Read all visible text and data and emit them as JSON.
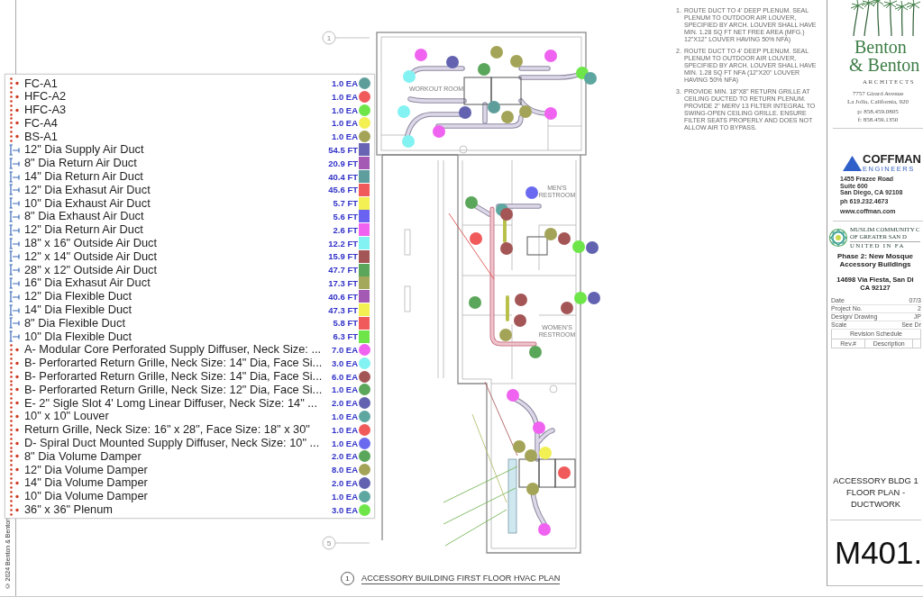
{
  "sheet_margin": {
    "copyright": "© 2024 Benton & Benton"
  },
  "legend": {
    "items": [
      {
        "kind": "count",
        "label": "FC-A1",
        "quantity": "1.0 EA",
        "color": "#5e9e9a"
      },
      {
        "kind": "count",
        "label": "HFC-A2",
        "quantity": "1.0 EA",
        "color": "#f05a5a"
      },
      {
        "kind": "count",
        "label": "HFC-A3",
        "quantity": "1.0 EA",
        "color": "#6ee64a"
      },
      {
        "kind": "count",
        "label": "FC-A4",
        "quantity": "1.0 EA",
        "color": "#f2f052"
      },
      {
        "kind": "count",
        "label": "BS-A1",
        "quantity": "1.0 EA",
        "color": "#a4a458"
      },
      {
        "kind": "length",
        "label": "12\" Dia Supply Air Duct",
        "quantity": "54.5 FT",
        "color": "#6a64b4"
      },
      {
        "kind": "length",
        "label": "8\" Dia Return Air Duct",
        "quantity": "20.9 FT",
        "color": "#a45ab4"
      },
      {
        "kind": "length",
        "label": "14\" Dia Return Air Duct",
        "quantity": "40.4 FT",
        "color": "#5e9e9e"
      },
      {
        "kind": "length",
        "label": "12\" Dia Exhasut Air Duct",
        "quantity": "45.6 FT",
        "color": "#f05a5a"
      },
      {
        "kind": "length",
        "label": "10\" Dia Exhaust Air Duct",
        "quantity": "5.7 FT",
        "color": "#f2f052"
      },
      {
        "kind": "length",
        "label": "8\" Dia Exhaust Air Duct",
        "quantity": "5.6 FT",
        "color": "#6a62f0"
      },
      {
        "kind": "length",
        "label": "12\" Dia Return Air Duct",
        "quantity": "2.6 FT",
        "color": "#f062f0"
      },
      {
        "kind": "length",
        "label": "18\" x 16\" Outside Air Duct",
        "quantity": "12.2 FT",
        "color": "#82f2f2"
      },
      {
        "kind": "length",
        "label": "12\" x 14\" Outside Air Duct",
        "quantity": "15.9 FT",
        "color": "#a45656"
      },
      {
        "kind": "length",
        "label": "28\" x 12\" Outside Air Duct",
        "quantity": "47.7 FT",
        "color": "#5aa65a"
      },
      {
        "kind": "length",
        "label": "16\" Dia Exhasut Air Duct",
        "quantity": "17.3 FT",
        "color": "#a4a85a"
      },
      {
        "kind": "length",
        "label": "12\" Dia Flexible Duct",
        "quantity": "40.6 FT",
        "color": "#a45ab4"
      },
      {
        "kind": "length",
        "label": "14\" Dia Flexible Duct",
        "quantity": "47.3 FT",
        "color": "#f2f052"
      },
      {
        "kind": "length",
        "label": "8\" Dia Flexible Duct",
        "quantity": "5.8 FT",
        "color": "#f05a5a"
      },
      {
        "kind": "length",
        "label": "10\" Dla Flexible Duct",
        "quantity": "6.3 FT",
        "color": "#6ee64a"
      },
      {
        "kind": "count",
        "label": "A- Modular Core Perforated Supply Diffuser, Neck Size: ...",
        "quantity": "7.0 EA",
        "color": "#f062f0"
      },
      {
        "kind": "count",
        "label": "B- Perforarted Return Grille, Neck Size: 14\" Dia, Face Si...",
        "quantity": "3.0 EA",
        "color": "#82f2f2"
      },
      {
        "kind": "count",
        "label": "B- Perforarted Return Grille, Neck Size: 14\" Dia, Face Si...",
        "quantity": "6.0 EA",
        "color": "#a45656"
      },
      {
        "kind": "count",
        "label": "B- Perforarted Return Grille, Neck Size: 12\" Dia, Face Si...",
        "quantity": "1.0 EA",
        "color": "#5aa65a"
      },
      {
        "kind": "count",
        "label": "E- 2\" Sigle Slot 4' Lomg Linear Diffuser, Neck Size: 14\" ...",
        "quantity": "2.0 EA",
        "color": "#6262b0"
      },
      {
        "kind": "count",
        "label": "10\" x 10\" Louver",
        "quantity": "1.0 EA",
        "color": "#5ea6a0"
      },
      {
        "kind": "count",
        "label": "Return Grille, Neck Size: 16\" x 28\", Face Size: 18\" x 30\"",
        "quantity": "1.0 EA",
        "color": "#f05a5a"
      },
      {
        "kind": "count",
        "label": "D- Spiral Duct Mounted Supply Diffuser, Neck Size: 10\" ...",
        "quantity": "1.0 EA",
        "color": "#6a6af0"
      },
      {
        "kind": "count",
        "label": "8\" Dia Volume Damper",
        "quantity": "2.0 EA",
        "color": "#5aa65a"
      },
      {
        "kind": "count",
        "label": "12\" Dia Volume Damper",
        "quantity": "8.0 EA",
        "color": "#a4a458"
      },
      {
        "kind": "count",
        "label": "14\" Dia Volume Damper",
        "quantity": "2.0 EA",
        "color": "#6262b0"
      },
      {
        "kind": "count",
        "label": "10\" Dia Volume Damper",
        "quantity": "1.0 EA",
        "color": "#5ea6a0"
      },
      {
        "kind": "count",
        "label": "36\" x 36\" Plenum",
        "quantity": "3.0 EA",
        "color": "#6ee64a"
      }
    ]
  },
  "plan": {
    "grid_bubbles": [
      "1",
      "5"
    ],
    "rooms": [
      {
        "lines": [
          "WORKOUT ROOM"
        ]
      },
      {
        "lines": [
          "MEN'S",
          "RESTROOM"
        ]
      },
      {
        "lines": [
          "WOMEN'S",
          "RESTROOM"
        ]
      }
    ],
    "title_number": "1",
    "title": "ACCESSORY BUILDING FIRST FLOOR HVAC PLAN"
  },
  "notes": [
    {
      "number": "1.",
      "text": "ROUTE DUCT TO 4' DEEP PLENUM. SEAL PLENUM TO OUTDOOR AIR LOUVER, SPECIFIED BY ARCH. LOUVER SHALL HAVE MIN. 1.28 SQ FT NET FREE AREA (MFG.) 12\"X12\" LOUVER HAVING 50% NFA)"
    },
    {
      "number": "2.",
      "text": "ROUTE DUCT TO 4' DEEP PLENUM. SEAL PLENUM TO OUTDOOR AIR LOUVER, SPECIFIED BY ARCH. LOUVER SHALL HAVE MIN. 1.28 SQ FT NFA (12\"X20\" LOUVER HAVING 50% NFA)"
    },
    {
      "number": "3.",
      "text": "PROVIDE MIN. 18\"X8\" RETURN GRILLE AT CEILING DUCTED TO RETURN PLENUM. PROVIDE 2\" MERV 13 FILTER INTEGRAL TO SWING-OPEN CEILING GRILLE. ENSURE FILTER SEATS PROPERLY AND DOES NOT ALLOW AIR TO BYPASS."
    }
  ],
  "title_block": {
    "architect": {
      "name_lines": [
        "Benton",
        "& Benton"
      ],
      "tagline": "ARCHITECTS",
      "address": [
        "7757 Girard Avenue",
        "La Jolla, California, 920"
      ],
      "phone": "p: 858.459.0805",
      "fax": "f: 858.459.1350"
    },
    "engineer": {
      "name": "COFFMAN",
      "tagline": "ENGINEERS",
      "address": [
        "1455 Frazee Road",
        "Suite 600",
        "San Diego, CA 92108"
      ],
      "phone": "ph 619.232.4673",
      "website": "www.coffman.com"
    },
    "client": {
      "name_lines": [
        "MUSLIM COMMUNITY C",
        "OF GREATER SAN D"
      ],
      "tagline": "UNITED IN FA"
    },
    "project": {
      "name_lines": [
        "Phase 2: New Mosque",
        "Accessory Buildings"
      ],
      "address_lines": [
        "14698 Via Fiesta, San Di",
        "CA 92127"
      ]
    },
    "info": [
      {
        "label": "Date",
        "value": "07/3"
      },
      {
        "label": "Project No.",
        "value": "2"
      },
      {
        "label": "Design/ Drawing",
        "value": "JP"
      },
      {
        "label": "Scale",
        "value": "See Dr"
      }
    ],
    "revision_schedule": {
      "title": "Revision Schedule",
      "columns": [
        "Rev.#",
        "Description"
      ]
    },
    "sheet_title": [
      "ACCESSORY BLDG 1",
      "FLOOR PLAN -",
      "DUCTWORK"
    ],
    "sheet_number": "M401."
  }
}
